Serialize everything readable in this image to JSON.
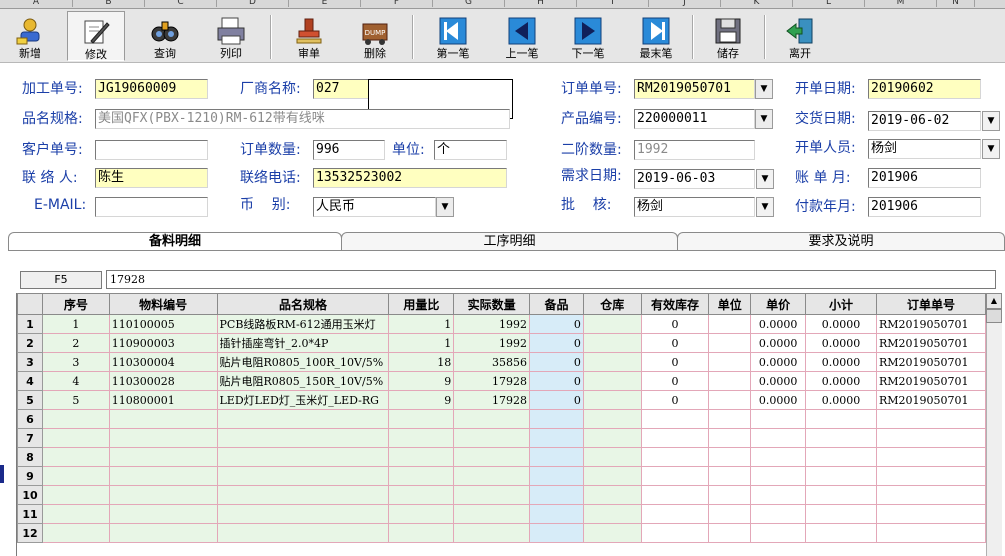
{
  "column_letters": [
    "A",
    "B",
    "C",
    "D",
    "E",
    "F",
    "G",
    "H",
    "I",
    "J",
    "K",
    "L",
    "M",
    "N"
  ],
  "toolbar": [
    {
      "label": "新增",
      "icon": "add-user-icon"
    },
    {
      "label": "修改",
      "icon": "edit-pen-icon"
    },
    {
      "label": "查询",
      "icon": "binoculars-icon"
    },
    {
      "label": "列印",
      "icon": "printer-icon"
    },
    {
      "label": "审单",
      "icon": "stamp-icon"
    },
    {
      "label": "删除",
      "icon": "trash-dump-icon"
    },
    {
      "label": "第一笔",
      "icon": "first-record-icon"
    },
    {
      "label": "上一笔",
      "icon": "prev-record-icon"
    },
    {
      "label": "下一笔",
      "icon": "next-record-icon"
    },
    {
      "label": "最末笔",
      "icon": "last-record-icon"
    },
    {
      "label": "储存",
      "icon": "floppy-save-icon"
    },
    {
      "label": "离开",
      "icon": "exit-door-icon"
    }
  ],
  "trash_icon_text": "DUMP",
  "form": {
    "process_no": {
      "label": "加工单号:",
      "value": "JG19060009"
    },
    "vendor": {
      "label": "厂商名称:",
      "value": "027"
    },
    "order_no": {
      "label": "订单单号:",
      "value": "RM2019050701"
    },
    "open_date": {
      "label": "开单日期:",
      "value": "20190602"
    },
    "spec": {
      "label": "品名规格:",
      "value": "美国QFX(PBX-1210)RM-612带有线咪"
    },
    "product_no": {
      "label": "产品编号:",
      "value": "220000011"
    },
    "delivery_date": {
      "label": "交货日期:",
      "value": "2019-06-02"
    },
    "customer_no": {
      "label": "客户单号:",
      "value": ""
    },
    "order_qty": {
      "label": "订单数量:",
      "value": "996"
    },
    "unit": {
      "label": "单位:",
      "value": "个"
    },
    "second_qty": {
      "label": "二阶数量:",
      "value": "1992"
    },
    "creator": {
      "label": "开单人员:",
      "value": "杨剑"
    },
    "contact": {
      "label": "联 络 人:",
      "value": "陈生"
    },
    "phone": {
      "label": "联络电话:",
      "value": "13532523002"
    },
    "demand_date": {
      "label": "需求日期:",
      "value": "2019-06-03"
    },
    "bill_month": {
      "label": "账 单 月:",
      "value": "201906"
    },
    "email": {
      "label": "E-MAIL:",
      "value": ""
    },
    "currency": {
      "label": "币    别:",
      "value": "人民币"
    },
    "approve": {
      "label": "批    核:",
      "value": "杨剑"
    },
    "pay_month": {
      "label": "付款年月:",
      "value": "201906"
    }
  },
  "tabs": [
    "备料明细",
    "工序明细",
    "要求及说明"
  ],
  "f5": {
    "label": "F5",
    "value": "17928"
  },
  "grid": {
    "headers": [
      "序号",
      "物料编号",
      "品名规格",
      "用量比",
      "实际数量",
      "备品",
      "仓库",
      "有效库存",
      "单位",
      "单价",
      "小计",
      "订单单号"
    ],
    "rows": [
      {
        "rn": "1",
        "seq": "1",
        "code": "110100005",
        "spec": "PCB线路板RM-612通用玉米灯",
        "ratio": "1",
        "qty": "1992",
        "spare": "0",
        "wh": "",
        "stock": "0",
        "unit": "",
        "price": "0.0000",
        "sub": "0.0000",
        "order": "RM2019050701"
      },
      {
        "rn": "2",
        "seq": "2",
        "code": "110900003",
        "spec": "插针插座弯针_2.0*4P",
        "ratio": "1",
        "qty": "1992",
        "spare": "0",
        "wh": "",
        "stock": "0",
        "unit": "",
        "price": "0.0000",
        "sub": "0.0000",
        "order": "RM2019050701"
      },
      {
        "rn": "3",
        "seq": "3",
        "code": "110300004",
        "spec": "贴片电阻R0805_100R_10V/5%",
        "ratio": "18",
        "qty": "35856",
        "spare": "0",
        "wh": "",
        "stock": "0",
        "unit": "",
        "price": "0.0000",
        "sub": "0.0000",
        "order": "RM2019050701"
      },
      {
        "rn": "4",
        "seq": "4",
        "code": "110300028",
        "spec": "贴片电阻R0805_150R_10V/5%",
        "ratio": "9",
        "qty": "17928",
        "spare": "0",
        "wh": "",
        "stock": "0",
        "unit": "",
        "price": "0.0000",
        "sub": "0.0000",
        "order": "RM2019050701"
      },
      {
        "rn": "5",
        "seq": "5",
        "code": "110800001",
        "spec": "LED灯LED灯_玉米灯_LED-RG",
        "ratio": "9",
        "qty": "17928",
        "spare": "0",
        "wh": "",
        "stock": "0",
        "unit": "",
        "price": "0.0000",
        "sub": "0.0000",
        "order": "RM2019050701"
      },
      {
        "rn": "6"
      },
      {
        "rn": "7"
      },
      {
        "rn": "8"
      },
      {
        "rn": "9"
      },
      {
        "rn": "10"
      },
      {
        "rn": "11"
      },
      {
        "rn": "12"
      }
    ]
  }
}
